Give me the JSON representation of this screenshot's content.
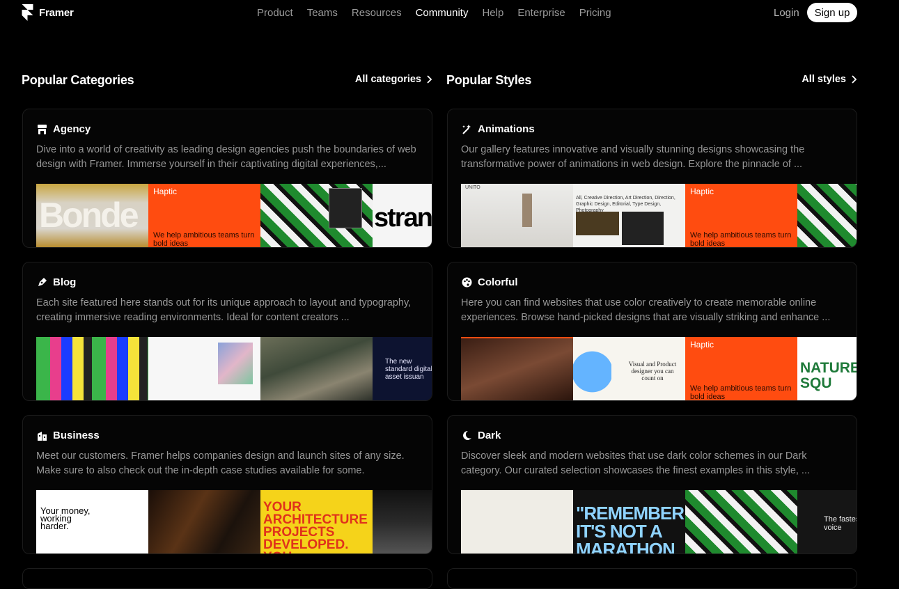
{
  "nav": {
    "brand": "Framer",
    "links": [
      "Product",
      "Teams",
      "Resources",
      "Community",
      "Help",
      "Enterprise",
      "Pricing"
    ],
    "active": "Community",
    "login": "Login",
    "signup": "Sign up"
  },
  "categories": {
    "title": "Popular Categories",
    "link": "All categories",
    "cards": [
      {
        "name": "Agency",
        "icon": "storefront-icon",
        "desc": "Dive into a world of creativity as leading design agencies push the boundaries of web design with Framer. Immerse yourself in their captivating digital experiences,...",
        "thumbs": [
          {
            "text": "Bonde"
          },
          {
            "title": "Haptic",
            "body": "We help ambitious teams turn bold ideas"
          },
          {
            "text": ""
          },
          {
            "text": "strang"
          }
        ]
      },
      {
        "name": "Blog",
        "icon": "pen-icon",
        "desc": "Each site featured here stands out for its unique approach to layout and typography, creating immersive reading environments. Ideal for content creators ...",
        "thumbs": [
          {
            "text": ""
          },
          {
            "text": ""
          },
          {
            "text": ""
          },
          {
            "text": "The new standard digital asset issuan"
          }
        ]
      },
      {
        "name": "Business",
        "icon": "building-icon",
        "desc": "Meet our customers. Framer helps companies design and launch sites of any size. Make sure to also check out the in-depth case studies available for some.",
        "thumbs": [
          {
            "text": "Your money, working harder."
          },
          {
            "text": ""
          },
          {
            "text": "YOUR ARCHITECTURE PROJECTS DEVELOPED. YOU"
          },
          {
            "text": ""
          }
        ]
      }
    ]
  },
  "styles": {
    "title": "Popular Styles",
    "link": "All styles",
    "cards": [
      {
        "name": "Animations",
        "icon": "magic-wand-icon",
        "desc": "Our gallery features innovative and visually stunning designs showcasing the transformative power of animations in web design. Explore the pinnacle of ...",
        "thumbs": [
          {
            "text": "UNITO"
          },
          {
            "text": "All, Creative Direction, Art Direction, Direction, Graphic Design, Editorial, Type Design, Photography"
          },
          {
            "title": "Haptic",
            "body": "We help ambitious teams turn bold ideas"
          },
          {
            "text": ""
          }
        ]
      },
      {
        "name": "Colorful",
        "icon": "palette-icon",
        "desc": "Here you can find websites that use color creatively to create memorable online experiences. Browse hand-picked designs that are visually striking and enhance ...",
        "thumbs": [
          {
            "text": ""
          },
          {
            "text": "Visual and Product designer you can count on"
          },
          {
            "title": "Haptic",
            "body": "We help ambitious teams turn bold ideas"
          },
          {
            "text": "NATURE'S SQU"
          }
        ]
      },
      {
        "name": "Dark",
        "icon": "moon-icon",
        "desc": "Discover sleek and modern websites that use dark color schemes in our Dark category. Our curated selection showcases the finest examples in this style, ...",
        "thumbs": [
          {
            "text": ""
          },
          {
            "text": "\"REMEMBER IT'S NOT A MARATHON"
          },
          {
            "text": ""
          },
          {
            "text": "The fastest voice"
          }
        ]
      }
    ]
  }
}
